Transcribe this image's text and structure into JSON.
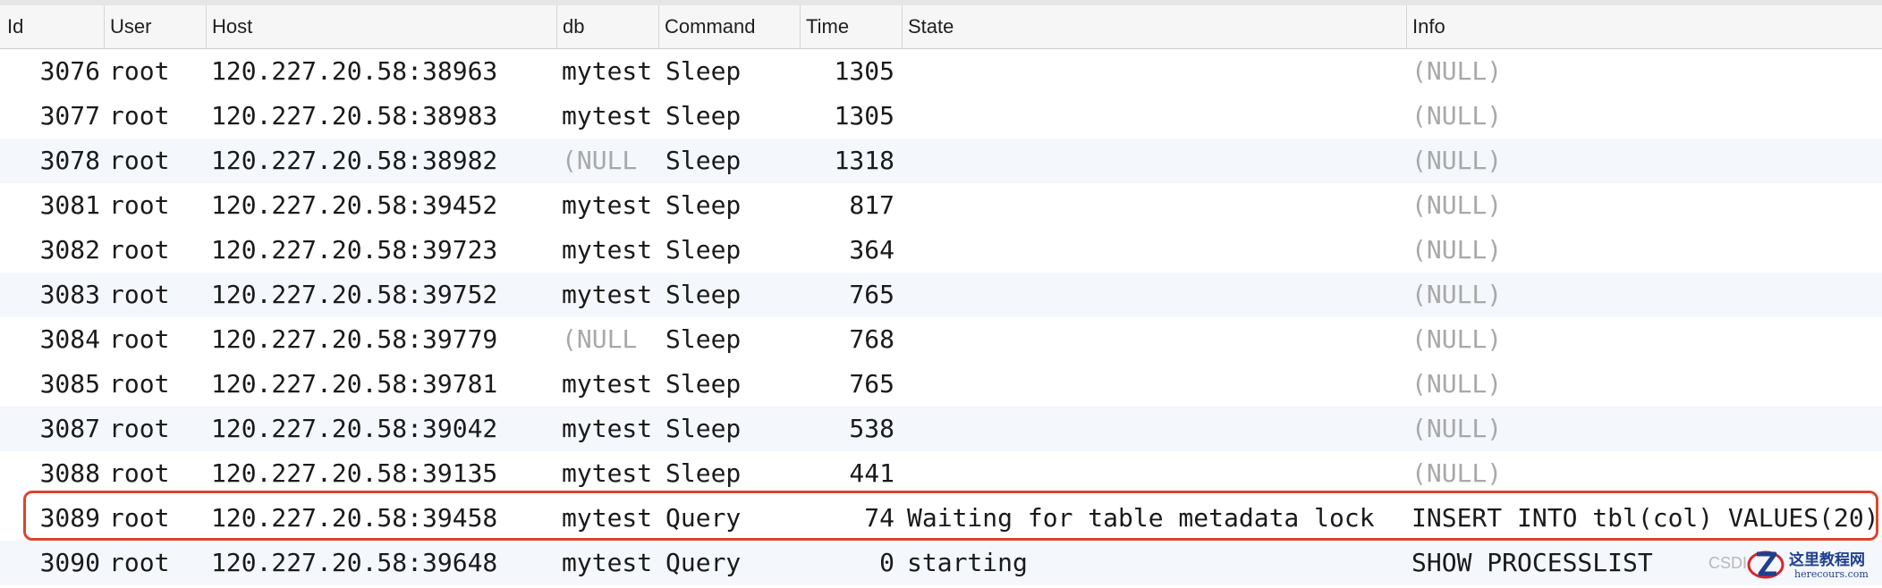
{
  "columns": [
    "Id",
    "User",
    "Host",
    "db",
    "Command",
    "Time",
    "State",
    "Info"
  ],
  "rows": [
    {
      "id": "3076",
      "user": "root",
      "host": "120.227.20.58:38963",
      "db": "mytest",
      "command": "Sleep",
      "time": "1305",
      "state": "",
      "info": "(NULL)"
    },
    {
      "id": "3077",
      "user": "root",
      "host": "120.227.20.58:38983",
      "db": "mytest",
      "command": "Sleep",
      "time": "1305",
      "state": "",
      "info": "(NULL)"
    },
    {
      "id": "3078",
      "user": "root",
      "host": "120.227.20.58:38982",
      "db": "(NULL",
      "command": "Sleep",
      "time": "1318",
      "state": "",
      "info": "(NULL)"
    },
    {
      "id": "3081",
      "user": "root",
      "host": "120.227.20.58:39452",
      "db": "mytest",
      "command": "Sleep",
      "time": "817",
      "state": "",
      "info": "(NULL)"
    },
    {
      "id": "3082",
      "user": "root",
      "host": "120.227.20.58:39723",
      "db": "mytest",
      "command": "Sleep",
      "time": "364",
      "state": "",
      "info": "(NULL)"
    },
    {
      "id": "3083",
      "user": "root",
      "host": "120.227.20.58:39752",
      "db": "mytest",
      "command": "Sleep",
      "time": "765",
      "state": "",
      "info": "(NULL)"
    },
    {
      "id": "3084",
      "user": "root",
      "host": "120.227.20.58:39779",
      "db": "(NULL",
      "command": "Sleep",
      "time": "768",
      "state": "",
      "info": "(NULL)"
    },
    {
      "id": "3085",
      "user": "root",
      "host": "120.227.20.58:39781",
      "db": "mytest",
      "command": "Sleep",
      "time": "765",
      "state": "",
      "info": "(NULL)"
    },
    {
      "id": "3087",
      "user": "root",
      "host": "120.227.20.58:39042",
      "db": "mytest",
      "command": "Sleep",
      "time": "538",
      "state": "",
      "info": "(NULL)"
    },
    {
      "id": "3088",
      "user": "root",
      "host": "120.227.20.58:39135",
      "db": "mytest",
      "command": "Sleep",
      "time": "441",
      "state": "",
      "info": "(NULL)"
    },
    {
      "id": "3089",
      "user": "root",
      "host": "120.227.20.58:39458",
      "db": "mytest",
      "command": "Query",
      "time": "74",
      "state": "Waiting for table metadata lock",
      "info": "INSERT INTO tbl(col) VALUES(20)"
    },
    {
      "id": "3090",
      "user": "root",
      "host": "120.227.20.58:39648",
      "db": "mytest",
      "command": "Query",
      "time": "0",
      "state": "starting",
      "info": "SHOW PROCESSLIST"
    }
  ],
  "null_marker": "(NULL",
  "highlighted_row_id": "3089",
  "colors": {
    "highlight_border": "#d9462c",
    "null_text": "#a8a8a8",
    "alt_row": "#f4f7fb"
  },
  "watermark": {
    "csdn": "CSDI",
    "brand": "这里教程网",
    "url": "herecours.com",
    "logo_icon": "z-logo-icon"
  }
}
